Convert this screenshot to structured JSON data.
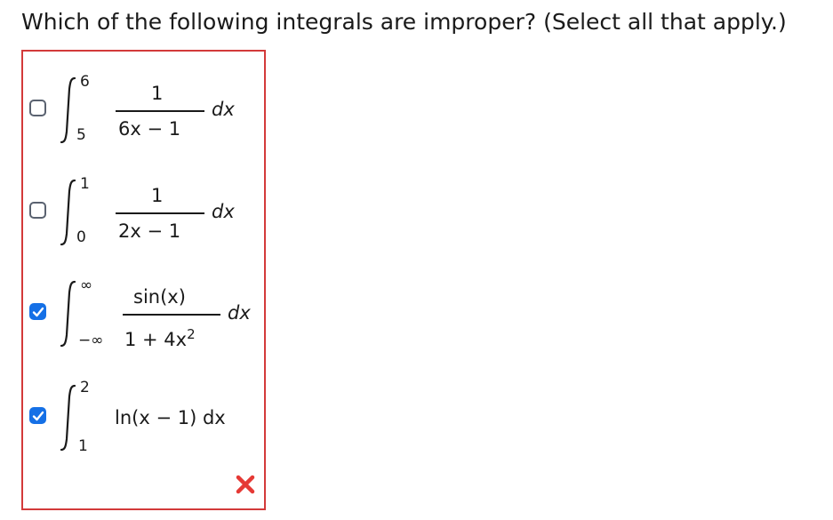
{
  "question": "Which of the following integrals are improper? (Select all that apply.)",
  "options": [
    {
      "checked": false,
      "upper": "6",
      "lower": "5",
      "numerator": "1",
      "denominator": "6x − 1",
      "differential": "dx"
    },
    {
      "checked": false,
      "upper": "1",
      "lower": "0",
      "numerator": "1",
      "denominator": "2x − 1",
      "differential": "dx"
    },
    {
      "checked": true,
      "upper": "∞",
      "lower": "−∞",
      "numerator": "sin(x)",
      "denominator_base": "1 + 4x",
      "denominator_exp": "2",
      "differential": "dx"
    },
    {
      "checked": true,
      "upper": "2",
      "lower": "1",
      "integrand": "ln(x − 1) dx"
    }
  ],
  "feedback": {
    "icon": "x-mark-icon",
    "color": "#e53935",
    "status": "incorrect"
  },
  "colors": {
    "box_border": "#d33a3a",
    "checkbox_checked": "#1570e6"
  }
}
